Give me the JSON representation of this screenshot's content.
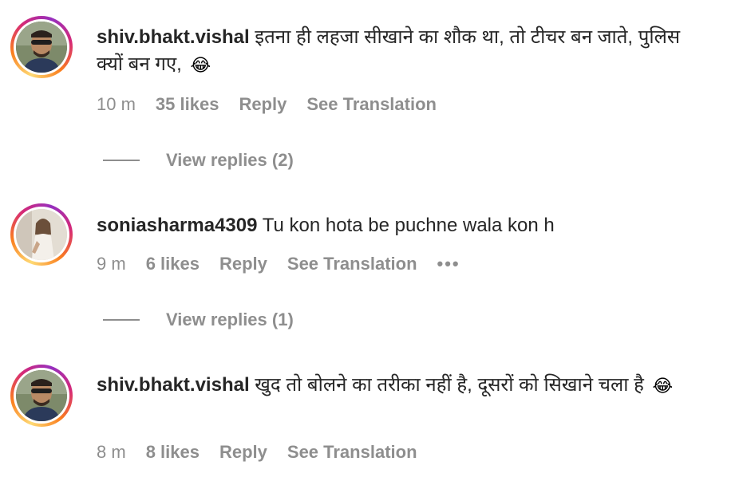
{
  "comments": [
    {
      "username": "shiv.bhakt.vishal",
      "text": "इतना ही लहजा सीखाने का शौक था, तो टीचर बन जाते, पुलिस क्यों बन गए,",
      "emoji": "😂",
      "time": "10 m",
      "likes": "35 likes",
      "reply": "Reply",
      "translate": "See Translation",
      "view_replies": "View replies (2)"
    },
    {
      "username": "soniasharma4309",
      "text": "Tu kon hota be puchne wala kon h",
      "time": "9 m",
      "likes": "6 likes",
      "reply": "Reply",
      "translate": "See Translation",
      "more": "•••",
      "view_replies": "View replies (1)"
    },
    {
      "username": "shiv.bhakt.vishal",
      "text": "खुद तो बोलने का तरीका नहीं है, दूसरों को सिखाने चला है",
      "emoji": "😂",
      "time": "8 m",
      "likes": "8 likes",
      "reply": "Reply",
      "translate": "See Translation"
    }
  ],
  "icons": {
    "avatar_1": "user-avatar-man-sunglasses",
    "avatar_2": "user-avatar-woman",
    "avatar_3": "user-avatar-man-sunglasses",
    "more": "more-options-icon"
  },
  "colors": {
    "username": "#262626",
    "meta": "#8e8e8e",
    "ring_start": "#feda75",
    "ring_mid": "#d62976",
    "ring_end": "#962fbf"
  }
}
